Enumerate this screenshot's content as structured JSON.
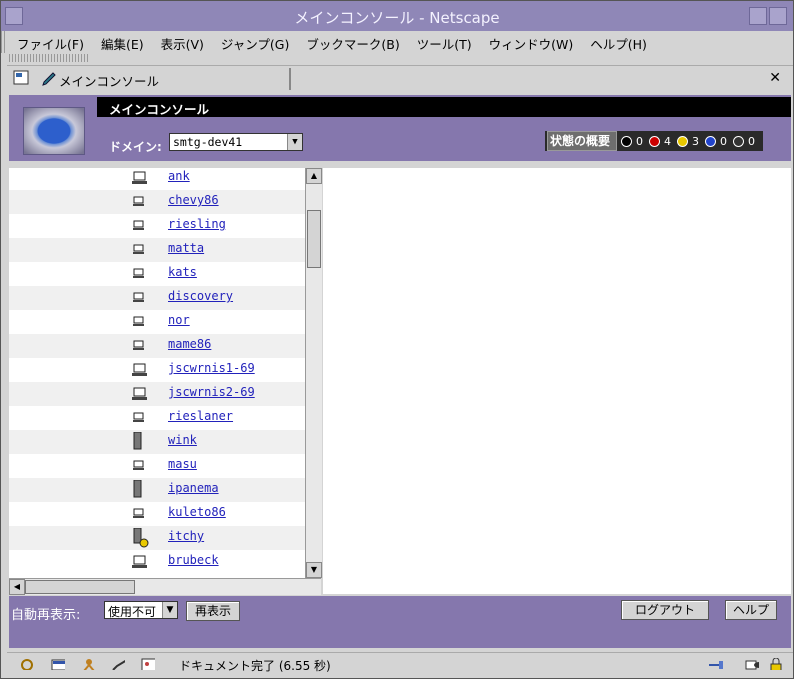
{
  "window": {
    "title": "メインコンソール - Netscape"
  },
  "menu": [
    "ファイル(F)",
    "編集(E)",
    "表示(V)",
    "ジャンプ(G)",
    "ブックマーク(B)",
    "ツール(T)",
    "ウィンドウ(W)",
    "ヘルプ(H)"
  ],
  "tab": {
    "label": "メインコンソール"
  },
  "header": {
    "title": "メインコンソール",
    "domain_label": "ドメイン:",
    "domain_value": "smtg-dev41",
    "status_label": "状態の概要",
    "status_counts": [
      {
        "name": "info",
        "count": "0",
        "color": "#000000"
      },
      {
        "name": "error",
        "count": "4",
        "color": "#cc0000"
      },
      {
        "name": "warning",
        "count": "3",
        "color": "#e8c800"
      },
      {
        "name": "minus",
        "count": "0",
        "color": "#2244cc"
      },
      {
        "name": "unknown",
        "count": "0",
        "color": "#333333"
      }
    ]
  },
  "hosts": [
    "ank",
    "chevy86",
    "riesling",
    "matta",
    "kats",
    "discovery",
    "nor",
    "mame86",
    "jscwrnis1-69",
    "jscwrnis2-69",
    "rieslaner",
    "wink",
    "masu",
    "ipanema",
    "kuleto86",
    "itchy",
    "brubeck"
  ],
  "bottom": {
    "auto_refresh_label": "自動再表示:",
    "auto_refresh_value": "使用不可",
    "refresh_button": "再表示",
    "logout_button": "ログアウト",
    "help_button": "ヘルプ"
  },
  "statusbar": {
    "message": "ドキュメント完了 (6.55 秒)"
  }
}
